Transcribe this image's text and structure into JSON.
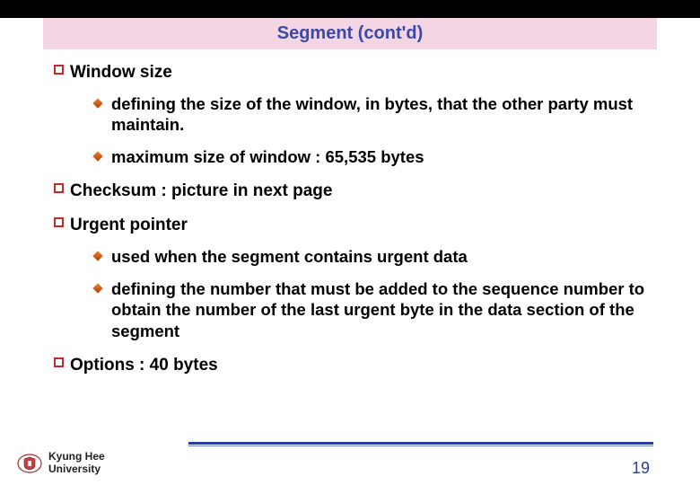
{
  "title": "Segment (cont'd)",
  "items": {
    "window_size": {
      "heading": "Window size",
      "sub": {
        "a": "defining the size of the window, in bytes, that the other party must maintain.",
        "b": "maximum size of window : 65,535 bytes"
      }
    },
    "checksum": {
      "heading": "Checksum : picture in next page"
    },
    "urgent_pointer": {
      "heading": "Urgent pointer",
      "sub": {
        "a": "used when the segment contains urgent data",
        "b": "defining the number that must be added to the sequence number to obtain the number of the last urgent byte in the data section of the segment"
      }
    },
    "options": {
      "heading": "Options : 40 bytes"
    }
  },
  "footer": {
    "university_line1": "Kyung Hee",
    "university_line2": "University",
    "page_number": "19"
  }
}
